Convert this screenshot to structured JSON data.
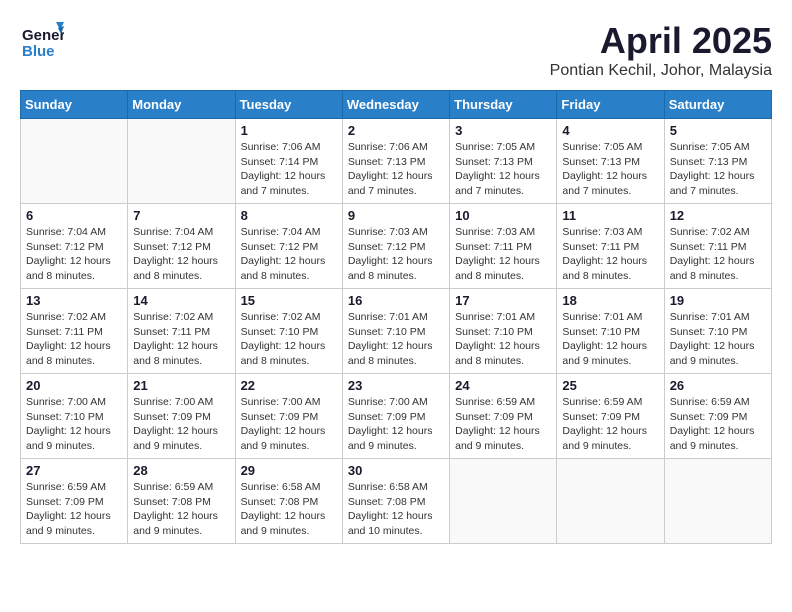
{
  "header": {
    "logo_line1": "General",
    "logo_line2": "Blue",
    "month_title": "April 2025",
    "location": "Pontian Kechil, Johor, Malaysia"
  },
  "weekdays": [
    "Sunday",
    "Monday",
    "Tuesday",
    "Wednesday",
    "Thursday",
    "Friday",
    "Saturday"
  ],
  "weeks": [
    [
      {
        "day": "",
        "info": ""
      },
      {
        "day": "",
        "info": ""
      },
      {
        "day": "1",
        "info": "Sunrise: 7:06 AM\nSunset: 7:14 PM\nDaylight: 12 hours\nand 7 minutes."
      },
      {
        "day": "2",
        "info": "Sunrise: 7:06 AM\nSunset: 7:13 PM\nDaylight: 12 hours\nand 7 minutes."
      },
      {
        "day": "3",
        "info": "Sunrise: 7:05 AM\nSunset: 7:13 PM\nDaylight: 12 hours\nand 7 minutes."
      },
      {
        "day": "4",
        "info": "Sunrise: 7:05 AM\nSunset: 7:13 PM\nDaylight: 12 hours\nand 7 minutes."
      },
      {
        "day": "5",
        "info": "Sunrise: 7:05 AM\nSunset: 7:13 PM\nDaylight: 12 hours\nand 7 minutes."
      }
    ],
    [
      {
        "day": "6",
        "info": "Sunrise: 7:04 AM\nSunset: 7:12 PM\nDaylight: 12 hours\nand 8 minutes."
      },
      {
        "day": "7",
        "info": "Sunrise: 7:04 AM\nSunset: 7:12 PM\nDaylight: 12 hours\nand 8 minutes."
      },
      {
        "day": "8",
        "info": "Sunrise: 7:04 AM\nSunset: 7:12 PM\nDaylight: 12 hours\nand 8 minutes."
      },
      {
        "day": "9",
        "info": "Sunrise: 7:03 AM\nSunset: 7:12 PM\nDaylight: 12 hours\nand 8 minutes."
      },
      {
        "day": "10",
        "info": "Sunrise: 7:03 AM\nSunset: 7:11 PM\nDaylight: 12 hours\nand 8 minutes."
      },
      {
        "day": "11",
        "info": "Sunrise: 7:03 AM\nSunset: 7:11 PM\nDaylight: 12 hours\nand 8 minutes."
      },
      {
        "day": "12",
        "info": "Sunrise: 7:02 AM\nSunset: 7:11 PM\nDaylight: 12 hours\nand 8 minutes."
      }
    ],
    [
      {
        "day": "13",
        "info": "Sunrise: 7:02 AM\nSunset: 7:11 PM\nDaylight: 12 hours\nand 8 minutes."
      },
      {
        "day": "14",
        "info": "Sunrise: 7:02 AM\nSunset: 7:11 PM\nDaylight: 12 hours\nand 8 minutes."
      },
      {
        "day": "15",
        "info": "Sunrise: 7:02 AM\nSunset: 7:10 PM\nDaylight: 12 hours\nand 8 minutes."
      },
      {
        "day": "16",
        "info": "Sunrise: 7:01 AM\nSunset: 7:10 PM\nDaylight: 12 hours\nand 8 minutes."
      },
      {
        "day": "17",
        "info": "Sunrise: 7:01 AM\nSunset: 7:10 PM\nDaylight: 12 hours\nand 8 minutes."
      },
      {
        "day": "18",
        "info": "Sunrise: 7:01 AM\nSunset: 7:10 PM\nDaylight: 12 hours\nand 9 minutes."
      },
      {
        "day": "19",
        "info": "Sunrise: 7:01 AM\nSunset: 7:10 PM\nDaylight: 12 hours\nand 9 minutes."
      }
    ],
    [
      {
        "day": "20",
        "info": "Sunrise: 7:00 AM\nSunset: 7:10 PM\nDaylight: 12 hours\nand 9 minutes."
      },
      {
        "day": "21",
        "info": "Sunrise: 7:00 AM\nSunset: 7:09 PM\nDaylight: 12 hours\nand 9 minutes."
      },
      {
        "day": "22",
        "info": "Sunrise: 7:00 AM\nSunset: 7:09 PM\nDaylight: 12 hours\nand 9 minutes."
      },
      {
        "day": "23",
        "info": "Sunrise: 7:00 AM\nSunset: 7:09 PM\nDaylight: 12 hours\nand 9 minutes."
      },
      {
        "day": "24",
        "info": "Sunrise: 6:59 AM\nSunset: 7:09 PM\nDaylight: 12 hours\nand 9 minutes."
      },
      {
        "day": "25",
        "info": "Sunrise: 6:59 AM\nSunset: 7:09 PM\nDaylight: 12 hours\nand 9 minutes."
      },
      {
        "day": "26",
        "info": "Sunrise: 6:59 AM\nSunset: 7:09 PM\nDaylight: 12 hours\nand 9 minutes."
      }
    ],
    [
      {
        "day": "27",
        "info": "Sunrise: 6:59 AM\nSunset: 7:09 PM\nDaylight: 12 hours\nand 9 minutes."
      },
      {
        "day": "28",
        "info": "Sunrise: 6:59 AM\nSunset: 7:08 PM\nDaylight: 12 hours\nand 9 minutes."
      },
      {
        "day": "29",
        "info": "Sunrise: 6:58 AM\nSunset: 7:08 PM\nDaylight: 12 hours\nand 9 minutes."
      },
      {
        "day": "30",
        "info": "Sunrise: 6:58 AM\nSunset: 7:08 PM\nDaylight: 12 hours\nand 10 minutes."
      },
      {
        "day": "",
        "info": ""
      },
      {
        "day": "",
        "info": ""
      },
      {
        "day": "",
        "info": ""
      }
    ]
  ]
}
